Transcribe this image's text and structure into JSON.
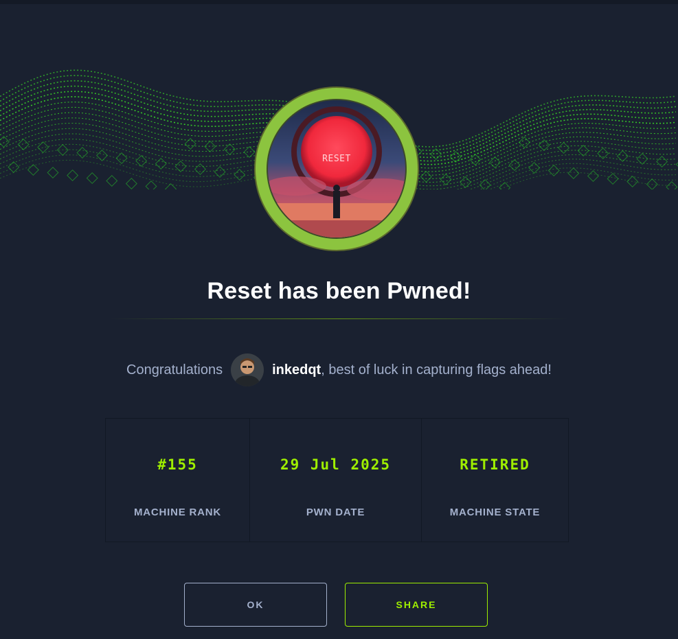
{
  "machine": {
    "name": "Reset",
    "badge_text": "RESET"
  },
  "header": {
    "title": "Reset has been Pwned!"
  },
  "congrats": {
    "prefix": "Congratulations",
    "username": "inkedqt",
    "suffix": ", best of luck in capturing flags ahead!"
  },
  "stats": [
    {
      "value": "#155",
      "label": "MACHINE RANK"
    },
    {
      "value": "29 Jul 2025",
      "label": "PWN DATE"
    },
    {
      "value": "RETIRED",
      "label": "MACHINE STATE"
    }
  ],
  "actions": {
    "ok_label": "OK",
    "share_label": "SHARE"
  },
  "colors": {
    "background": "#1a2130",
    "accent": "#9fef00",
    "badge_ring": "#8cc43f",
    "muted_text": "#a4b1cd"
  }
}
